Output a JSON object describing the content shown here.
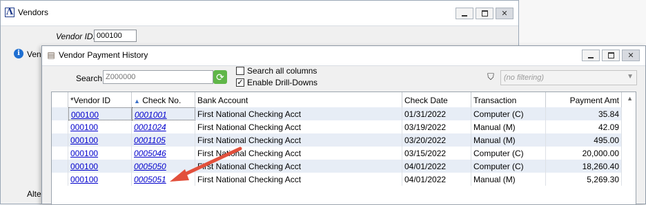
{
  "back_window": {
    "title": "Vendors",
    "vendor_id_label": "Vendor ID:",
    "vendor_id_value": "000100",
    "tab_label_partial": "Vend",
    "alt_label_partial": "Alte",
    "logo_glyph": "Λ"
  },
  "front_window": {
    "title": "Vendor Payment History",
    "search": {
      "label": "Search:",
      "placeholder": "Z000000"
    },
    "search_all_columns": {
      "label": "Search all columns",
      "checked": false
    },
    "enable_drill_downs": {
      "label": "Enable Drill-Downs",
      "checked": true
    },
    "filter": {
      "value": "(no filtering)"
    },
    "columns": [
      "*Vendor ID",
      "Check No.",
      "Bank Account",
      "Check Date",
      "Transaction",
      "Payment Amt"
    ],
    "rows": [
      {
        "vendor_id": "000100",
        "check_no": "0001001",
        "bank": "First National Checking Acct",
        "date": "01/31/2022",
        "transaction": "Computer (C)",
        "amount": "35.84"
      },
      {
        "vendor_id": "000100",
        "check_no": "0001024",
        "bank": "First National Checking Acct",
        "date": "03/19/2022",
        "transaction": "Manual (M)",
        "amount": "42.09"
      },
      {
        "vendor_id": "000100",
        "check_no": "0001105",
        "bank": "First National Checking Acct",
        "date": "03/20/2022",
        "transaction": "Manual (M)",
        "amount": "495.00"
      },
      {
        "vendor_id": "000100",
        "check_no": "0005046",
        "bank": "First National Checking Acct",
        "date": "03/15/2022",
        "transaction": "Computer (C)",
        "amount": "20,000.00"
      },
      {
        "vendor_id": "000100",
        "check_no": "0005050",
        "bank": "First National Checking Acct",
        "date": "04/01/2022",
        "transaction": "Computer (C)",
        "amount": "18,260.40"
      },
      {
        "vendor_id": "000100",
        "check_no": "0005051",
        "bank": "First National Checking Acct",
        "date": "04/01/2022",
        "transaction": "Manual (M)",
        "amount": "5,269.30"
      }
    ]
  },
  "colors": {
    "link": "#0000cc",
    "alt_row": "#e7edf6",
    "annotation_arrow": "#e2503c"
  }
}
